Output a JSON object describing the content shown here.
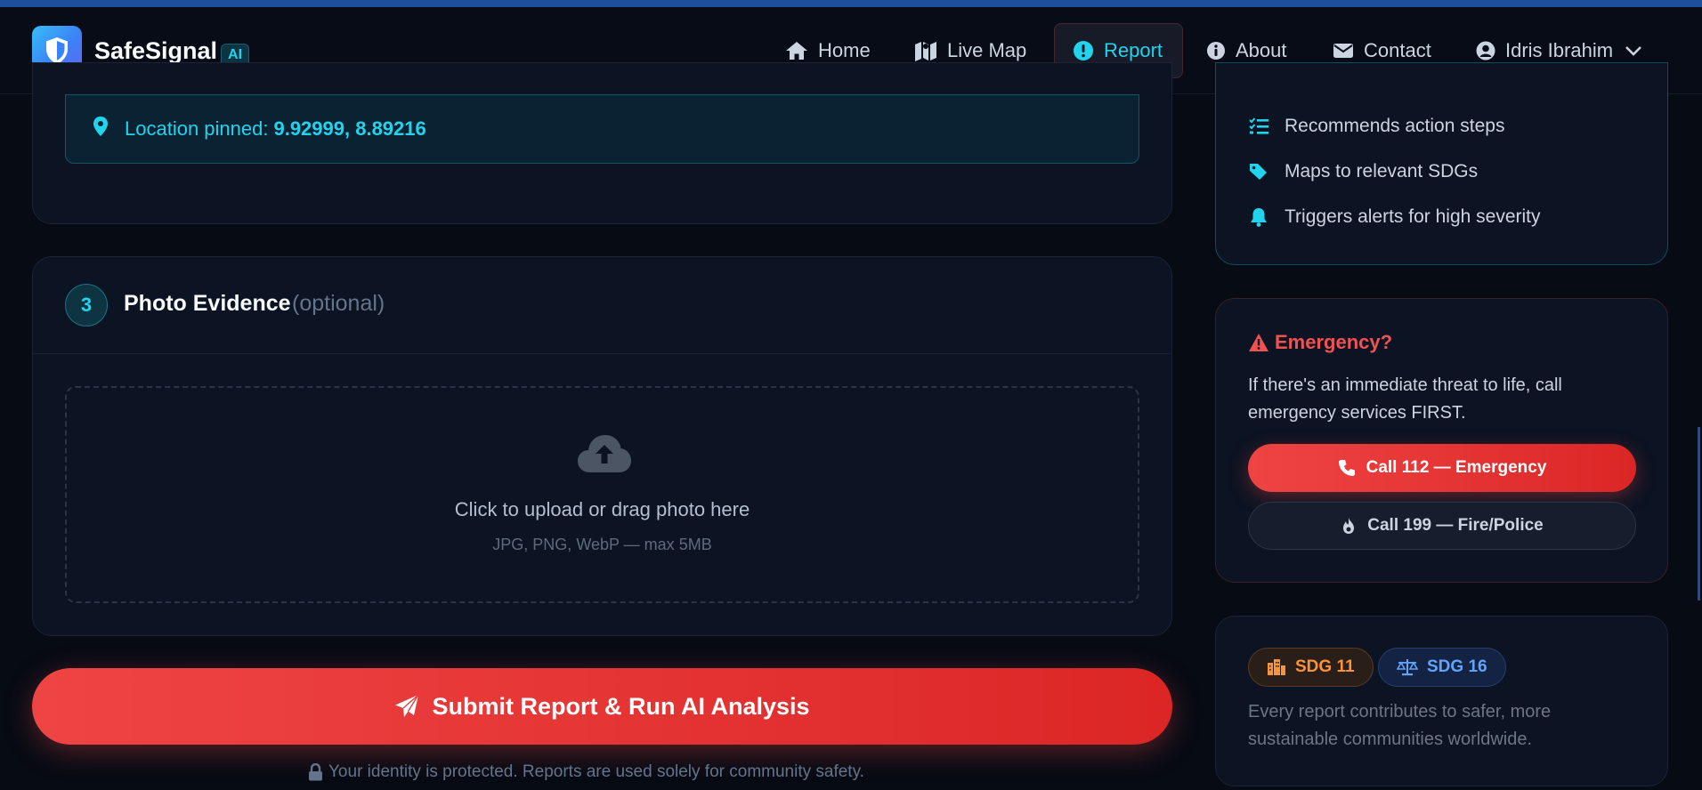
{
  "brand": {
    "name": "SafeSignal",
    "badge": "AI"
  },
  "nav": {
    "home": "Home",
    "live_map": "Live Map",
    "report": "Report",
    "about": "About",
    "contact": "Contact",
    "user": "Idris Ibrahim"
  },
  "location": {
    "label": "Location pinned:",
    "coords": "9.92999, 8.89216"
  },
  "photo_section": {
    "step": "3",
    "title": "Photo Evidence",
    "optional": "(optional)",
    "upload_text": "Click to upload or drag photo here",
    "upload_hint": "JPG, PNG, WebP — max 5MB"
  },
  "submit": {
    "label": "Submit Report & Run AI Analysis"
  },
  "privacy": {
    "text": "Your identity is protected. Reports are used solely for community safety."
  },
  "features": [
    {
      "icon": "list-check-icon",
      "label": "Recommends action steps"
    },
    {
      "icon": "tag-icon",
      "label": "Maps to relevant SDGs"
    },
    {
      "icon": "bell-icon",
      "label": "Triggers alerts for high severity"
    }
  ],
  "emergency": {
    "title": "Emergency?",
    "text": "If there's an immediate threat to life, call emergency services FIRST.",
    "call_emergency": "Call 112 — Emergency",
    "call_fire_police": "Call 199 — Fire/Police"
  },
  "sdg": {
    "sdg11": "SDG 11",
    "sdg16": "SDG 16",
    "text": "Every report contributes to safer, more sustainable communities worldwide."
  },
  "colors": {
    "accent": "#22d3ee",
    "danger": "#ef4444",
    "sdg11": "#fb923c",
    "sdg16": "#60a5fa"
  }
}
